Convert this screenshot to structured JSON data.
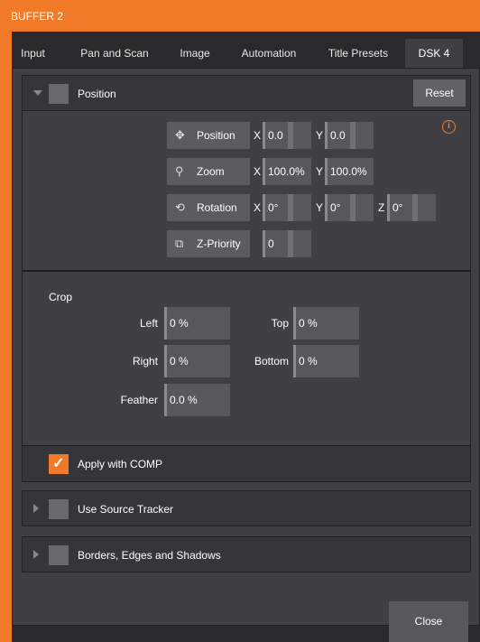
{
  "window": {
    "title": "BUFFER 2"
  },
  "tabs": [
    {
      "label": "Input"
    },
    {
      "label": "Pan and Scan"
    },
    {
      "label": "Image"
    },
    {
      "label": "Automation"
    },
    {
      "label": "Title Presets"
    },
    {
      "label": "DSK 4",
      "active": true
    }
  ],
  "position_section": {
    "label": "Position",
    "expanded": true,
    "reset_label": "Reset",
    "position": {
      "button_label": "Position",
      "x_axis": "X",
      "x_value": "0.0",
      "y_axis": "Y",
      "y_value": "0.0"
    },
    "zoom": {
      "button_label": "Zoom",
      "x_axis": "X",
      "x_value": "100.0%",
      "y_axis": "Y",
      "y_value": "100.0%"
    },
    "rotation": {
      "button_label": "Rotation",
      "x_axis": "X",
      "x_value": "0°",
      "y_axis": "Y",
      "y_value": "0°",
      "z_axis": "Z",
      "z_value": "0°"
    },
    "zpriority": {
      "button_label": "Z-Priority",
      "value": "0"
    },
    "info_icon": "i"
  },
  "crop": {
    "title": "Crop",
    "left_label": "Left",
    "left_value": "0 %",
    "top_label": "Top",
    "top_value": "0 %",
    "right_label": "Right",
    "right_value": "0 %",
    "bottom_label": "Bottom",
    "bottom_value": "0 %",
    "feather_label": "Feather",
    "feather_value": "0.0 %"
  },
  "apply_comp": {
    "label": "Apply with COMP",
    "checked": true
  },
  "source_tracker": {
    "label": "Use Source Tracker",
    "expanded": false
  },
  "borders": {
    "label": "Borders, Edges and Shadows",
    "expanded": false
  },
  "footer": {
    "close_label": "Close"
  },
  "colors": {
    "accent": "#f07a28",
    "panel": "#404044",
    "background": "#2a2a2c"
  }
}
